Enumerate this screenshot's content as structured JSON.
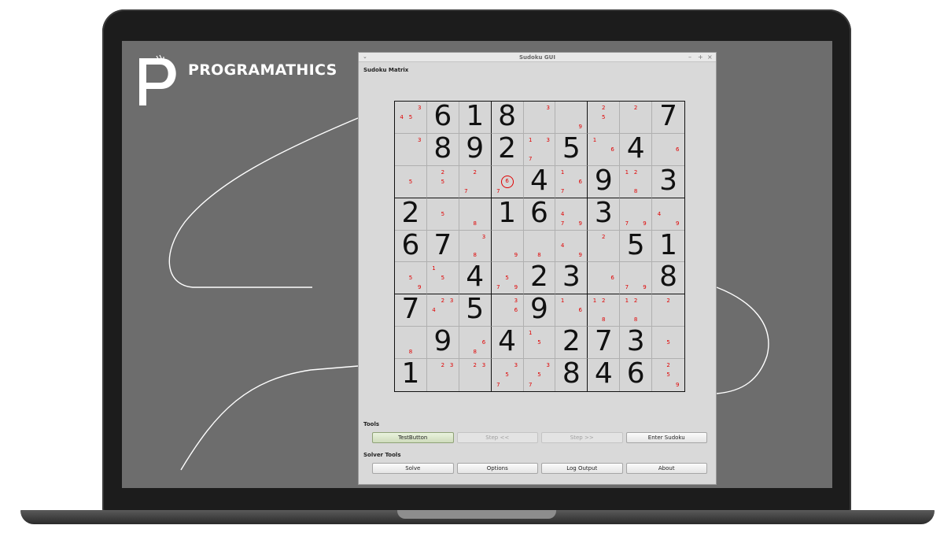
{
  "brand": {
    "name": "PROGRAMATHICS",
    "logo_glyphs": "{/}<>"
  },
  "window": {
    "title": "Sudoku GUI",
    "controls": [
      "–",
      "+",
      "×"
    ],
    "menu_caret": "⌄"
  },
  "sections": {
    "matrix": "Sudoku Matrix",
    "tools": "Tools",
    "solver_tools": "Solver Tools"
  },
  "tools_buttons": [
    {
      "label": "TestButton",
      "state": "active"
    },
    {
      "label": "Step <<",
      "state": "disabled"
    },
    {
      "label": "Step >>",
      "state": "disabled"
    },
    {
      "label": "Enter Sudoku",
      "state": "normal"
    }
  ],
  "solver_buttons": [
    {
      "label": "Solve"
    },
    {
      "label": "Options"
    },
    {
      "label": "Log Output"
    },
    {
      "label": "About"
    }
  ],
  "highlight": {
    "row": 2,
    "col": 3,
    "value": "6"
  },
  "colors": {
    "candidate": "#e00000",
    "given": "#111111",
    "screen_bg": "#6d6d6d",
    "window_bg": "#d9d9d9"
  },
  "grid": [
    [
      {
        "c": [
          3,
          4,
          5
        ]
      },
      {
        "v": 6
      },
      {
        "v": 1
      },
      {
        "v": 8
      },
      {
        "c": [
          3
        ]
      },
      {
        "c": [
          9
        ]
      },
      {
        "c": [
          2,
          5
        ]
      },
      {
        "c": [
          2
        ]
      },
      {
        "v": 7
      }
    ],
    [
      {
        "c": [
          3
        ]
      },
      {
        "v": 8
      },
      {
        "v": 9
      },
      {
        "v": 2
      },
      {
        "c": [
          1,
          3,
          7
        ]
      },
      {
        "v": 5
      },
      {
        "c": [
          1,
          6
        ]
      },
      {
        "v": 4
      },
      {
        "c": [
          6
        ]
      }
    ],
    [
      {
        "c": [
          5
        ]
      },
      {
        "c": [
          2,
          5
        ]
      },
      {
        "c": [
          2,
          7
        ]
      },
      {
        "c": [
          7
        ]
      },
      {
        "v": 4
      },
      {
        "c": [
          1,
          6,
          7
        ]
      },
      {
        "v": 9
      },
      {
        "c": [
          1,
          2,
          8
        ]
      },
      {
        "v": 3
      }
    ],
    [
      {
        "v": 2
      },
      {
        "c": [
          5
        ]
      },
      {
        "c": [
          8
        ]
      },
      {
        "v": 1
      },
      {
        "v": 6
      },
      {
        "c": [
          4,
          7,
          9
        ]
      },
      {
        "v": 3
      },
      {
        "c": [
          7,
          9
        ]
      },
      {
        "c": [
          4,
          9
        ]
      }
    ],
    [
      {
        "v": 6
      },
      {
        "v": 7
      },
      {
        "c": [
          3,
          8
        ]
      },
      {
        "c": [
          9
        ]
      },
      {
        "c": [
          8
        ]
      },
      {
        "c": [
          4,
          9
        ]
      },
      {
        "c": [
          2
        ]
      },
      {
        "v": 5
      },
      {
        "v": 1
      }
    ],
    [
      {
        "c": [
          5,
          9
        ]
      },
      {
        "c": [
          1,
          5
        ]
      },
      {
        "v": 4
      },
      {
        "c": [
          5,
          7,
          9
        ]
      },
      {
        "v": 2
      },
      {
        "v": 3
      },
      {
        "c": [
          6
        ]
      },
      {
        "c": [
          7,
          9
        ]
      },
      {
        "v": 8
      }
    ],
    [
      {
        "v": 7
      },
      {
        "c": [
          2,
          3,
          4
        ]
      },
      {
        "v": 5
      },
      {
        "c": [
          3,
          6
        ]
      },
      {
        "v": 9
      },
      {
        "c": [
          1,
          6
        ]
      },
      {
        "c": [
          1,
          2,
          8
        ]
      },
      {
        "c": [
          1,
          2,
          8
        ]
      },
      {
        "c": [
          2
        ]
      }
    ],
    [
      {
        "c": [
          8
        ]
      },
      {
        "v": 9
      },
      {
        "c": [
          6,
          8
        ]
      },
      {
        "v": 4
      },
      {
        "c": [
          1,
          5
        ]
      },
      {
        "v": 2
      },
      {
        "v": 7
      },
      {
        "v": 3
      },
      {
        "c": [
          5
        ]
      }
    ],
    [
      {
        "v": 1
      },
      {
        "c": [
          2,
          3
        ]
      },
      {
        "c": [
          2,
          3
        ]
      },
      {
        "c": [
          3,
          5,
          7
        ]
      },
      {
        "c": [
          3,
          5,
          7
        ]
      },
      {
        "v": 8
      },
      {
        "v": 4
      },
      {
        "v": 6
      },
      {
        "c": [
          2,
          5,
          9
        ]
      }
    ]
  ]
}
